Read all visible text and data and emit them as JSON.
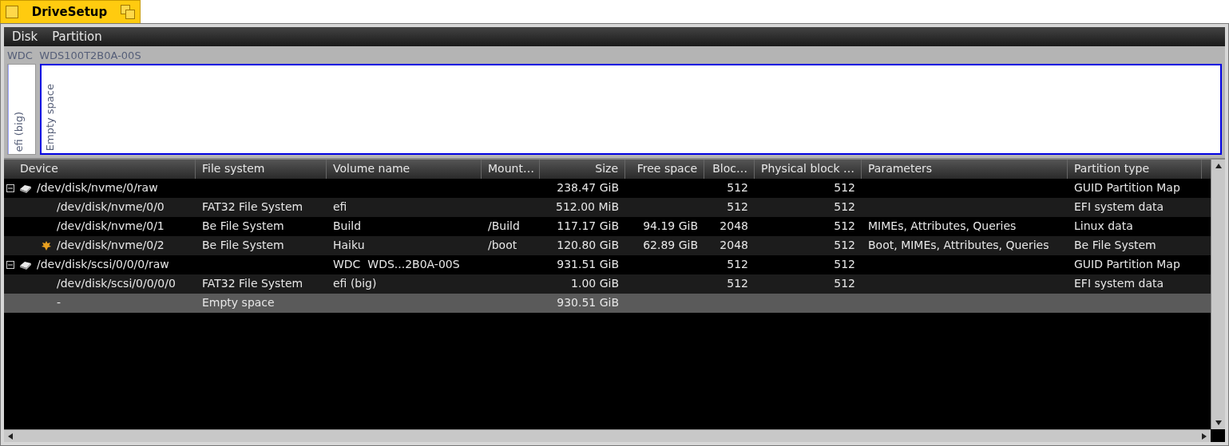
{
  "window": {
    "title": "DriveSetup"
  },
  "menu": [
    "Disk",
    "Partition"
  ],
  "disk_map": {
    "label": "WDC  WDS100T2B0A-00S",
    "partitions": [
      {
        "label": "efi (big)",
        "selected": false
      },
      {
        "label": "Empty space",
        "selected": true
      }
    ]
  },
  "table": {
    "columns": [
      "Device",
      "File system",
      "Volume name",
      "Mount…",
      "Size",
      "Free space",
      "Bloc…",
      "Physical block …",
      "Parameters",
      "Partition type"
    ],
    "rows": [
      {
        "kind": "disk",
        "expanded": true,
        "selected": false,
        "cells": [
          "/dev/disk/nvme/0/raw",
          "",
          "",
          "",
          "238.47 GiB",
          "",
          "512",
          "512",
          "",
          "GUID Partition Map"
        ],
        "children": [
          {
            "kind": "partition",
            "selected": false,
            "cells": [
              "/dev/disk/nvme/0/0",
              "FAT32 File System",
              "efi",
              "",
              "512.00 MiB",
              "",
              "512",
              "512",
              "",
              "EFI system data"
            ]
          },
          {
            "kind": "partition",
            "selected": false,
            "cells": [
              "/dev/disk/nvme/0/1",
              "Be File System",
              "Build",
              "/Build",
              "117.17 GiB",
              "94.19 GiB",
              "2048",
              "512",
              "MIMEs, Attributes, Queries",
              "Linux data"
            ]
          },
          {
            "kind": "boot",
            "selected": false,
            "cells": [
              "/dev/disk/nvme/0/2",
              "Be File System",
              "Haiku",
              "/boot",
              "120.80 GiB",
              "62.89 GiB",
              "2048",
              "512",
              "Boot, MIMEs, Attributes, Queries",
              "Be File System"
            ]
          }
        ]
      },
      {
        "kind": "disk",
        "expanded": true,
        "selected": false,
        "cells": [
          "/dev/disk/scsi/0/0/0/raw",
          "",
          "WDC  WDS...2B0A-00S",
          "",
          "931.51 GiB",
          "",
          "512",
          "512",
          "",
          "GUID Partition Map"
        ],
        "children": [
          {
            "kind": "partition",
            "selected": false,
            "cells": [
              "/dev/disk/scsi/0/0/0/0",
              "FAT32 File System",
              "efi (big)",
              "",
              "1.00 GiB",
              "",
              "512",
              "512",
              "",
              "EFI system data"
            ]
          },
          {
            "kind": "partition",
            "selected": true,
            "cells": [
              "-",
              "Empty space",
              "",
              "",
              "930.51 GiB",
              "",
              "",
              "",
              "",
              ""
            ]
          }
        ]
      }
    ]
  }
}
